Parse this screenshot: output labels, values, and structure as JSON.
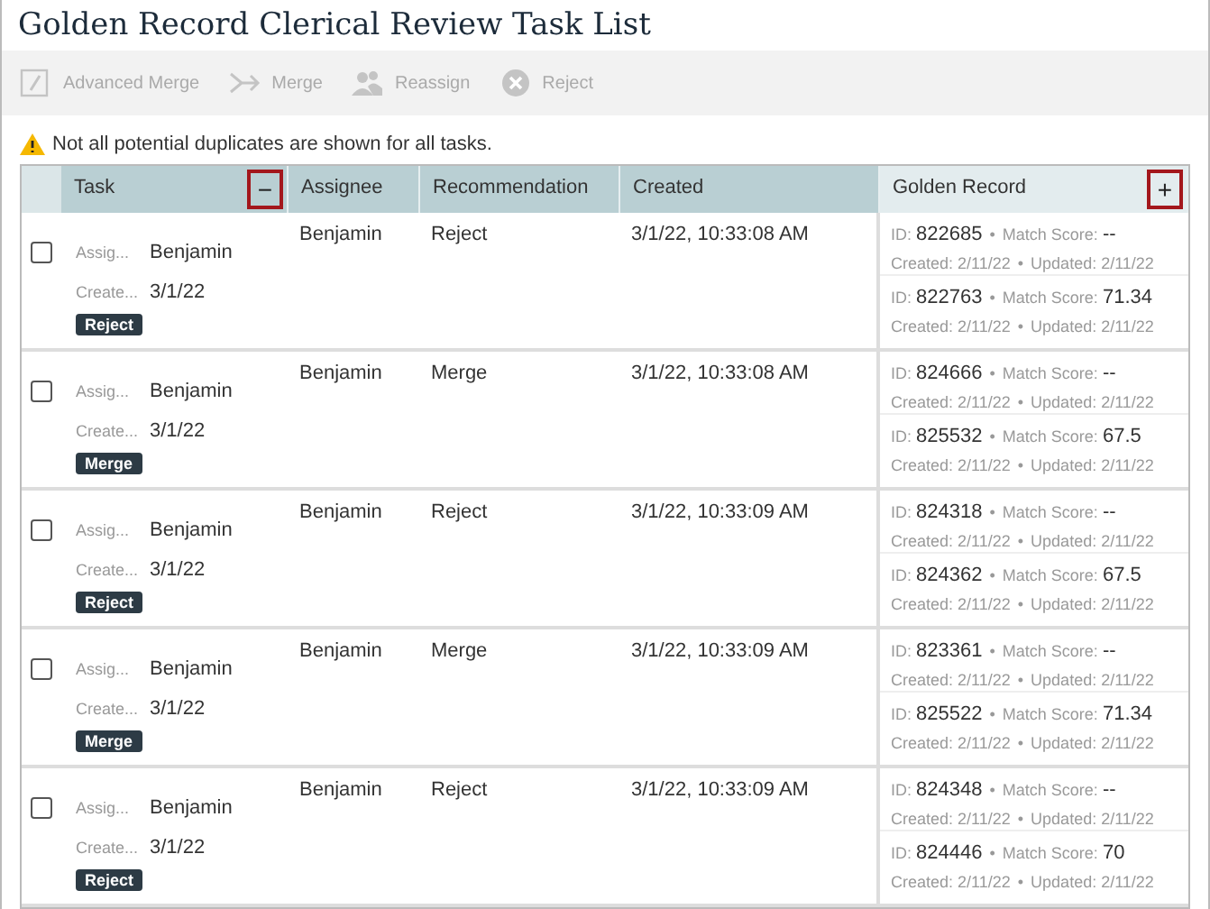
{
  "title": "Golden Record Clerical Review Task List",
  "toolbar": [
    {
      "kind": "advanced-merge",
      "label": "Advanced Merge",
      "disabled": true
    },
    {
      "kind": "merge",
      "label": "Merge",
      "disabled": true
    },
    {
      "kind": "reassign",
      "label": "Reassign",
      "disabled": true
    },
    {
      "kind": "reject",
      "label": "Reject",
      "disabled": true
    }
  ],
  "warning": "Not all potential duplicates are shown for all tasks.",
  "columns": [
    {
      "label": "Task",
      "toggle": "−"
    },
    {
      "label": "Assignee"
    },
    {
      "label": "Recommendation"
    },
    {
      "label": "Created"
    },
    {
      "label": "Golden Record",
      "toggle": "+"
    }
  ],
  "rows": [
    {
      "checked": false,
      "assignee_label": "Assig...",
      "assignee_value": "Benjamin",
      "created_label": "Create...",
      "created_value": "3/1/22",
      "badge": "Reject",
      "assignee": "Benjamin",
      "recommendation": "Reject",
      "created": "3/1/22, 10:33:08 AM",
      "records": [
        {
          "id_label": "ID:",
          "id": "822685",
          "sep1": "•",
          "score_label": "Match Score:",
          "score": "--",
          "created": "Created: 2/11/22",
          "sep2": "•",
          "updated": "Updated: 2/11/22"
        },
        {
          "id_label": "ID:",
          "id": "822763",
          "sep1": "•",
          "score_label": "Match Score:",
          "score": "71.34",
          "created": "Created: 2/11/22",
          "sep2": "•",
          "updated": "Updated: 2/11/22"
        }
      ]
    },
    {
      "checked": false,
      "assignee_label": "Assig...",
      "assignee_value": "Benjamin",
      "created_label": "Create...",
      "created_value": "3/1/22",
      "badge": "Merge",
      "assignee": "Benjamin",
      "recommendation": "Merge",
      "created": "3/1/22, 10:33:08 AM",
      "records": [
        {
          "id_label": "ID:",
          "id": "824666",
          "sep1": "•",
          "score_label": "Match Score:",
          "score": "--",
          "created": "Created: 2/11/22",
          "sep2": "•",
          "updated": "Updated: 2/11/22"
        },
        {
          "id_label": "ID:",
          "id": "825532",
          "sep1": "•",
          "score_label": "Match Score:",
          "score": "67.5",
          "created": "Created: 2/11/22",
          "sep2": "•",
          "updated": "Updated: 2/11/22"
        }
      ]
    },
    {
      "checked": false,
      "assignee_label": "Assig...",
      "assignee_value": "Benjamin",
      "created_label": "Create...",
      "created_value": "3/1/22",
      "badge": "Reject",
      "assignee": "Benjamin",
      "recommendation": "Reject",
      "created": "3/1/22, 10:33:09 AM",
      "records": [
        {
          "id_label": "ID:",
          "id": "824318",
          "sep1": "•",
          "score_label": "Match Score:",
          "score": "--",
          "created": "Created: 2/11/22",
          "sep2": "•",
          "updated": "Updated: 2/11/22"
        },
        {
          "id_label": "ID:",
          "id": "824362",
          "sep1": "•",
          "score_label": "Match Score:",
          "score": "67.5",
          "created": "Created: 2/11/22",
          "sep2": "•",
          "updated": "Updated: 2/11/22"
        }
      ]
    },
    {
      "checked": false,
      "assignee_label": "Assig...",
      "assignee_value": "Benjamin",
      "created_label": "Create...",
      "created_value": "3/1/22",
      "badge": "Merge",
      "assignee": "Benjamin",
      "recommendation": "Merge",
      "created": "3/1/22, 10:33:09 AM",
      "records": [
        {
          "id_label": "ID:",
          "id": "823361",
          "sep1": "•",
          "score_label": "Match Score:",
          "score": "--",
          "created": "Created: 2/11/22",
          "sep2": "•",
          "updated": "Updated: 2/11/22"
        },
        {
          "id_label": "ID:",
          "id": "825522",
          "sep1": "•",
          "score_label": "Match Score:",
          "score": "71.34",
          "created": "Created: 2/11/22",
          "sep2": "•",
          "updated": "Updated: 2/11/22"
        }
      ]
    },
    {
      "checked": false,
      "assignee_label": "Assig...",
      "assignee_value": "Benjamin",
      "created_label": "Create...",
      "created_value": "3/1/22",
      "badge": "Reject",
      "assignee": "Benjamin",
      "recommendation": "Reject",
      "created": "3/1/22, 10:33:09 AM",
      "records": [
        {
          "id_label": "ID:",
          "id": "824348",
          "sep1": "•",
          "score_label": "Match Score:",
          "score": "--",
          "created": "Created: 2/11/22",
          "sep2": "•",
          "updated": "Updated: 2/11/22"
        },
        {
          "id_label": "ID:",
          "id": "824446",
          "sep1": "•",
          "score_label": "Match Score:",
          "score": "70",
          "created": "Created: 2/11/22",
          "sep2": "•",
          "updated": "Updated: 2/11/22"
        }
      ]
    }
  ]
}
